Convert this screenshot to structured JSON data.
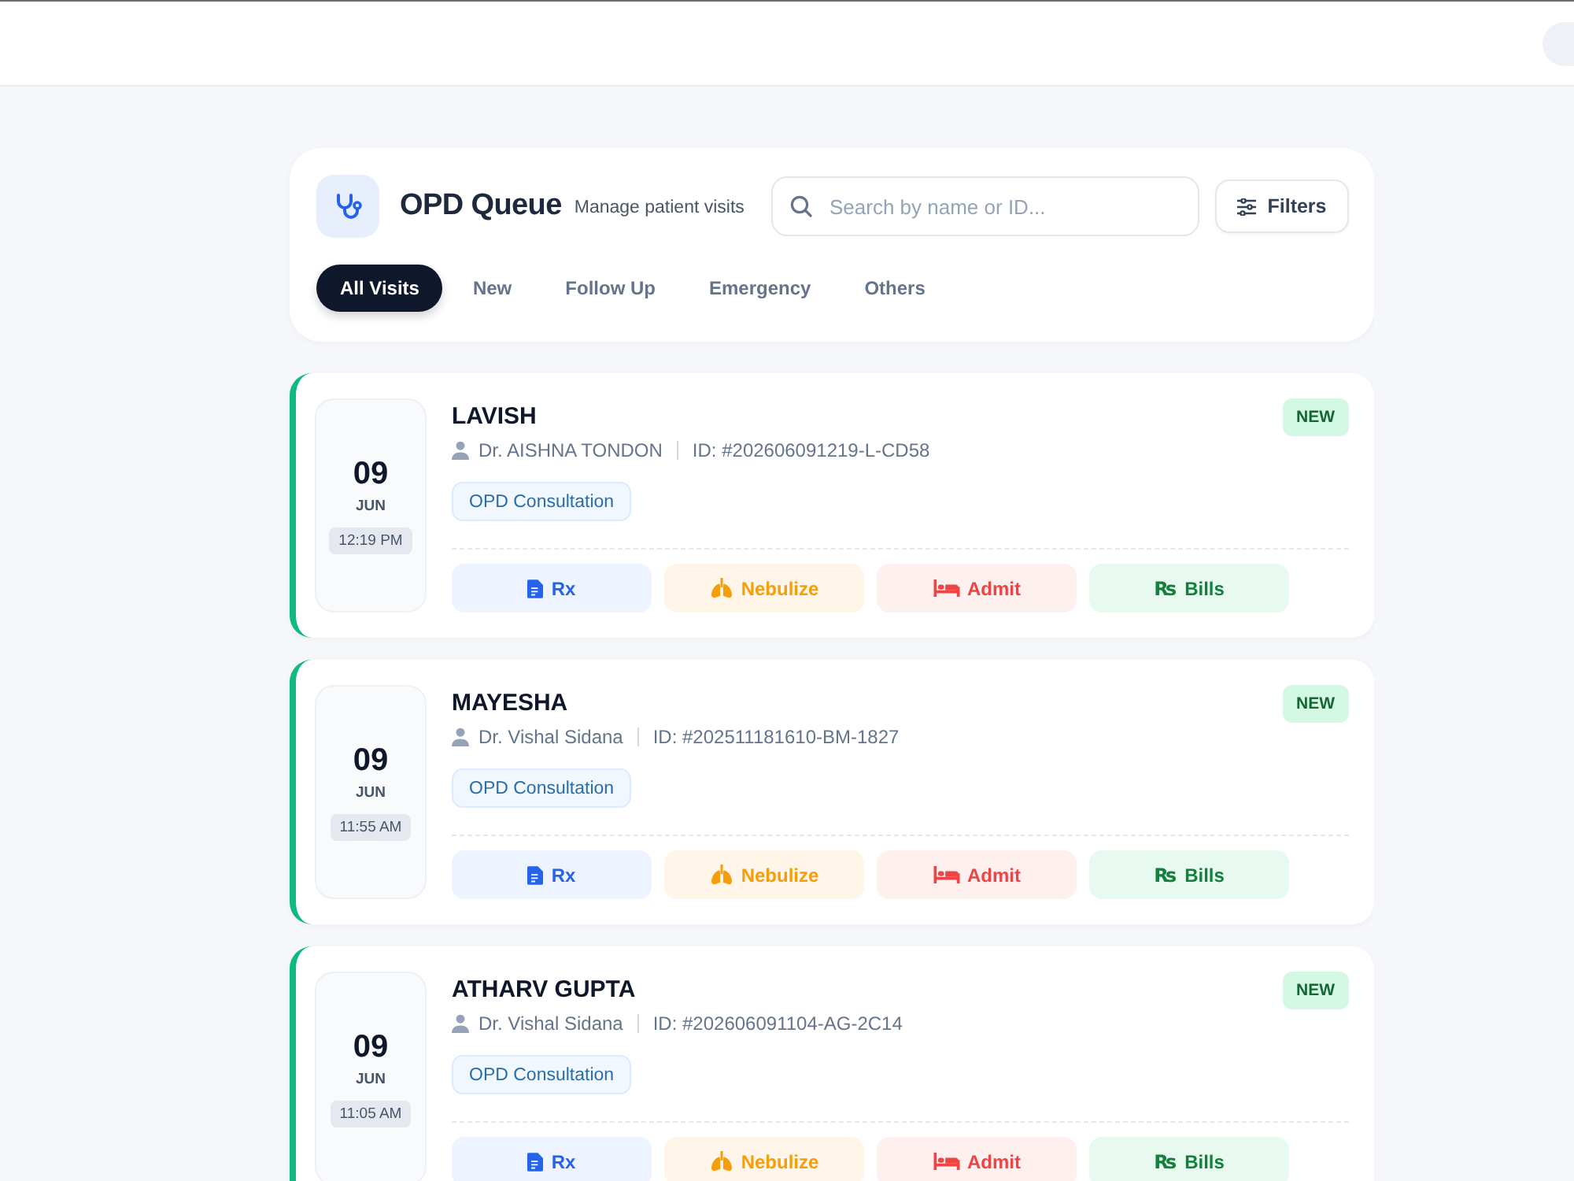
{
  "header": {
    "title": "OPD Queue",
    "subtitle": "Manage patient visits",
    "search": {
      "placeholder": "Search by name or ID..."
    },
    "filters_button": "Filters"
  },
  "tabs": [
    {
      "label": "All Visits",
      "selected": true
    },
    {
      "label": "New",
      "selected": false
    },
    {
      "label": "Follow Up",
      "selected": false
    },
    {
      "label": "Emergency",
      "selected": false
    },
    {
      "label": "Others",
      "selected": false
    }
  ],
  "visits": [
    {
      "day": "09",
      "month": "JUN",
      "time": "12:19 PM",
      "name": "LAVISH",
      "doctor": "Dr. AISHNA TONDON",
      "visit_id": "ID: #202606091219-L-CD58",
      "type": "OPD Consultation",
      "status": "NEW",
      "actions": [
        {
          "kind": "rx",
          "label": "Rx"
        },
        {
          "kind": "nebulize",
          "label": "Nebulize"
        },
        {
          "kind": "admit",
          "label": "Admit"
        },
        {
          "kind": "bills",
          "label": "Bills",
          "symbol": "₨"
        }
      ]
    },
    {
      "day": "09",
      "month": "JUN",
      "time": "11:55 AM",
      "name": "MAYESHA",
      "doctor": "Dr. Vishal Sidana",
      "visit_id": "ID: #202511181610-BM-1827",
      "type": "OPD Consultation",
      "status": "NEW",
      "actions": [
        {
          "kind": "rx",
          "label": "Rx"
        },
        {
          "kind": "nebulize",
          "label": "Nebulize"
        },
        {
          "kind": "admit",
          "label": "Admit"
        },
        {
          "kind": "bills",
          "label": "Bills",
          "symbol": "₨"
        }
      ]
    },
    {
      "day": "09",
      "month": "JUN",
      "time": "11:05 AM",
      "name": "ATHARV GUPTA",
      "doctor": "Dr. Vishal Sidana",
      "visit_id": "ID: #202606091104-AG-2C14",
      "type": "OPD Consultation",
      "status": "NEW",
      "actions": [
        {
          "kind": "rx",
          "label": "Rx"
        },
        {
          "kind": "nebulize",
          "label": "Nebulize"
        },
        {
          "kind": "admit",
          "label": "Admit"
        },
        {
          "kind": "bills",
          "label": "Bills",
          "symbol": "₨"
        }
      ]
    }
  ]
}
